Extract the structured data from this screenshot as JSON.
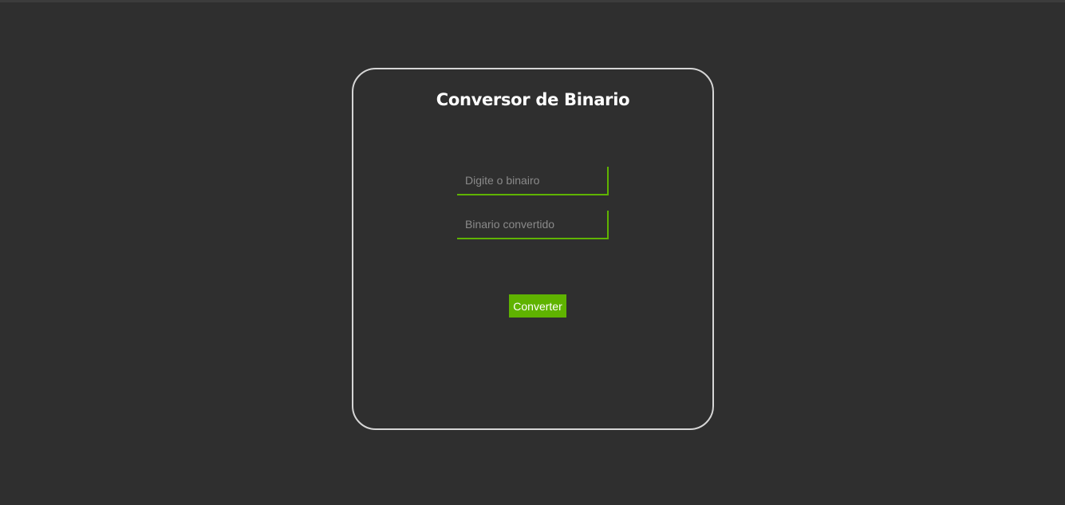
{
  "app": {
    "title": "Conversor de Binario"
  },
  "form": {
    "binary_input": {
      "placeholder": "Digite o binairo",
      "value": ""
    },
    "converted_output": {
      "placeholder": "Binario convertido",
      "value": ""
    },
    "convert_label": "Converter"
  },
  "colors": {
    "background": "#2f2f2f",
    "card_border": "#d6d6d6",
    "accent": "#5fb300",
    "placeholder": "#8a8a8a",
    "title": "#ffffff"
  }
}
